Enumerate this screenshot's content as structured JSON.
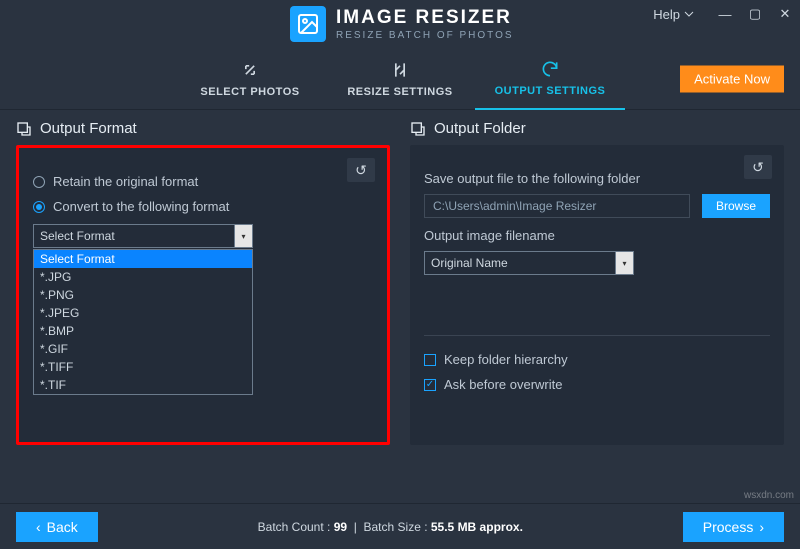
{
  "app": {
    "title": "IMAGE RESIZER",
    "subtitle": "RESIZE BATCH OF PHOTOS"
  },
  "help": {
    "label": "Help"
  },
  "tabs": {
    "select": "SELECT PHOTOS",
    "resize": "RESIZE SETTINGS",
    "output": "OUTPUT SETTINGS"
  },
  "activate": {
    "label": "Activate Now"
  },
  "outputFormat": {
    "heading": "Output Format",
    "retain": "Retain the original format",
    "convert": "Convert to the following format",
    "selected": "Select Format",
    "options": [
      "Select Format",
      "*.JPG",
      "*.PNG",
      "*.JPEG",
      "*.BMP",
      "*.GIF",
      "*.TIFF",
      "*.TIF"
    ]
  },
  "outputFolder": {
    "heading": "Output Folder",
    "saveLabel": "Save output file to the following folder",
    "path": "C:\\Users\\admin\\Image Resizer",
    "browse": "Browse",
    "filenameLabel": "Output image filename",
    "filenameSelected": "Original Name",
    "keepHierarchy": "Keep folder hierarchy",
    "askOverwrite": "Ask before overwrite"
  },
  "footer": {
    "back": "Back",
    "process": "Process",
    "countLabel": "Batch Count : ",
    "count": "99",
    "sizeLabel": "Batch Size : ",
    "size": "55.5 MB approx."
  },
  "watermark": "wsxdn.com"
}
